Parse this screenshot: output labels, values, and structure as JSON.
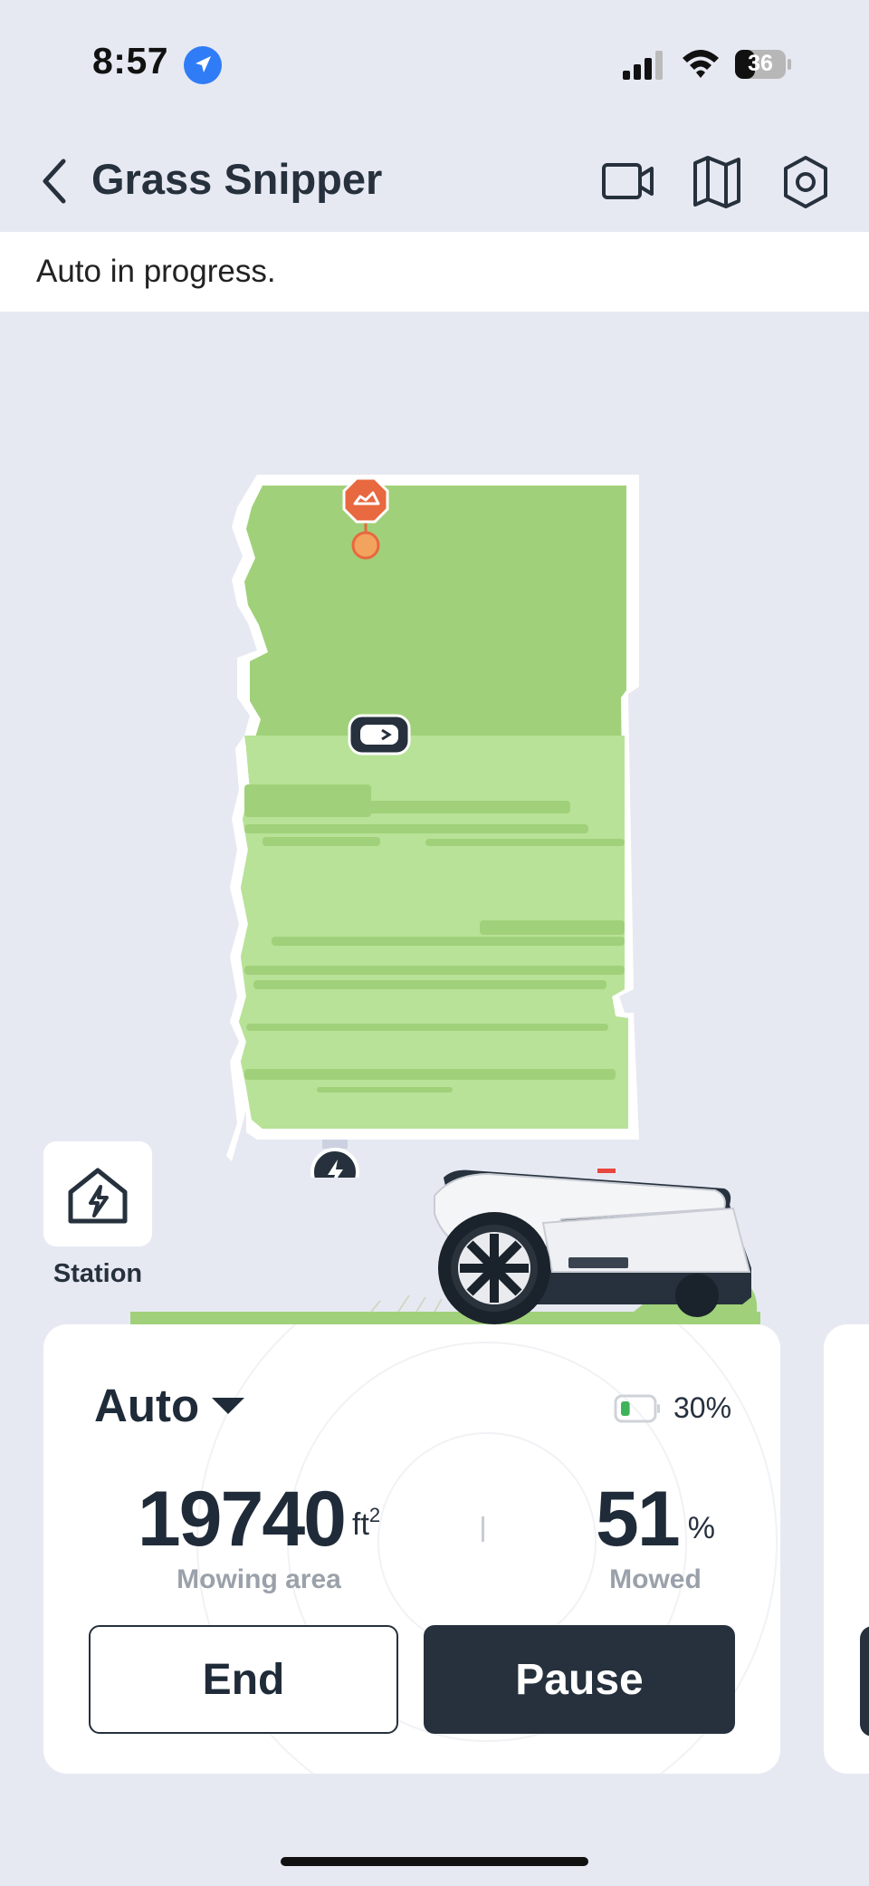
{
  "status_bar": {
    "time": "8:57",
    "battery_level": "36",
    "location_icon": "location-arrow-icon",
    "signal_icon": "cellular-signal-icon",
    "wifi_icon": "wifi-icon"
  },
  "header": {
    "title": "Grass Snipper",
    "back_icon": "chevron-left-icon",
    "camera_icon": "video-camera-icon",
    "map_icon": "map-icon",
    "settings_icon": "hexagon-gear-icon"
  },
  "status_banner": {
    "message": "Auto in progress."
  },
  "map": {
    "lawn_color": "#a0d17a",
    "mowed_color": "#b8e297",
    "border_color": "#ffffff",
    "obstacle_color": "#e8683f",
    "robot_icon": "mower-robot-icon",
    "charger_icon": "charging-bolt-icon",
    "obstacle_icon": "obstacle-marker-icon"
  },
  "station": {
    "label": "Station",
    "icon": "house-bolt-icon"
  },
  "control_card": {
    "mode": "Auto",
    "battery_percent": "30%",
    "battery_fill": 0.3,
    "area_value": "19740",
    "area_unit": "ft",
    "area_unit_sup": "2",
    "area_label": "Mowing area",
    "mowed_value": "51",
    "mowed_unit": "%",
    "mowed_label": "Mowed",
    "end_label": "End",
    "pause_label": "Pause",
    "battery_color": "#3fb35a"
  }
}
